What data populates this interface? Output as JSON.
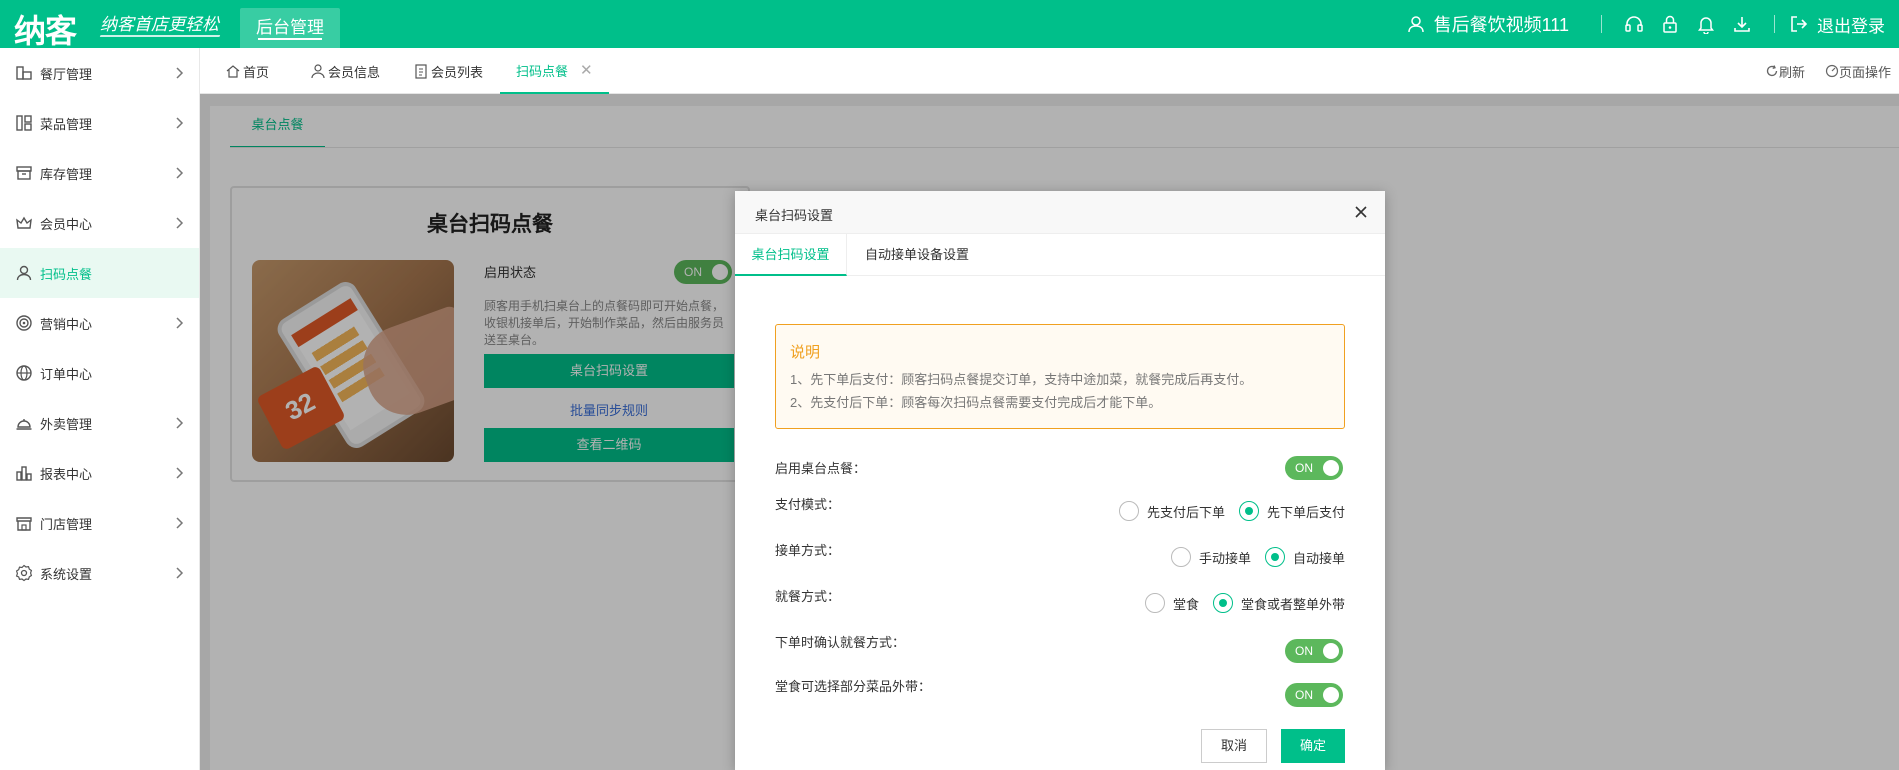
{
  "header": {
    "logo_text": "纳客",
    "slogan": "纳客首店更轻松",
    "backend_tab": "后台管理",
    "user_name": "售后餐饮视频111",
    "logout": "退出登录"
  },
  "sidebar": {
    "items": [
      {
        "label": "餐厅管理",
        "icon": "restaurant-icon",
        "has_chevron": true
      },
      {
        "label": "菜品管理",
        "icon": "dishes-icon",
        "has_chevron": true
      },
      {
        "label": "库存管理",
        "icon": "inventory-icon",
        "has_chevron": true
      },
      {
        "label": "会员中心",
        "icon": "crown-icon",
        "has_chevron": true
      },
      {
        "label": "扫码点餐",
        "icon": "user-icon",
        "has_chevron": false,
        "active": true
      },
      {
        "label": "营销中心",
        "icon": "target-icon",
        "has_chevron": true
      },
      {
        "label": "订单中心",
        "icon": "globe-icon",
        "has_chevron": false
      },
      {
        "label": "外卖管理",
        "icon": "cloche-icon",
        "has_chevron": true
      },
      {
        "label": "报表中心",
        "icon": "bar-chart-icon",
        "has_chevron": true
      },
      {
        "label": "门店管理",
        "icon": "store-icon",
        "has_chevron": true
      },
      {
        "label": "系统设置",
        "icon": "gear-icon",
        "has_chevron": true
      }
    ]
  },
  "tabs": {
    "items": [
      {
        "label": "首页",
        "icon": "home-icon"
      },
      {
        "label": "会员信息",
        "icon": "member-icon"
      },
      {
        "label": "会员列表",
        "icon": "clipboard-icon"
      },
      {
        "label": "扫码点餐",
        "active": true,
        "closable": true
      }
    ],
    "refresh": "刷新",
    "page_ops": "页面操作"
  },
  "content": {
    "sub_tab": "桌台点餐",
    "card": {
      "title": "桌台扫码点餐",
      "status_label": "启用状态",
      "status_toggle": "ON",
      "description": "顾客用手机扫桌台上的点餐码即可开始点餐，收银机接单后，开始制作菜品，然后由服务员送至桌台。",
      "settings_button": "桌台扫码设置",
      "sync_link": "批量同步规则",
      "qrcode_button": "查看二维码",
      "image_tag": "32"
    }
  },
  "modal": {
    "title": "桌台扫码设置",
    "tabs": [
      "桌台扫码设置",
      "自动接单设备设置"
    ],
    "notice": {
      "title": "说明",
      "lines": [
        "1、先下单后支付：顾客扫码点餐提交订单，支持中途加菜，就餐完成后再支付。",
        "2、先支付后下单：顾客每次扫码点餐需要支付完成后才能下单。"
      ]
    },
    "settings": {
      "enable": {
        "label": "启用桌台点餐：",
        "value": "ON"
      },
      "payment": {
        "label": "支付模式：",
        "options": [
          "先支付后下单",
          "先下单后支付"
        ],
        "selected": "先下单后支付"
      },
      "accept": {
        "label": "接单方式：",
        "options": [
          "手动接单",
          "自动接单"
        ],
        "selected": "自动接单"
      },
      "dining": {
        "label": "就餐方式：",
        "options": [
          "堂食",
          "堂食或者整单外带"
        ],
        "selected": "堂食或者整单外带"
      },
      "confirm_dining": {
        "label": "下单时确认就餐方式：",
        "value": "ON"
      },
      "partial_takeout": {
        "label": "堂食可选择部分菜品外带：",
        "value": "ON"
      }
    },
    "cancel": "取消",
    "confirm": "确定"
  },
  "colors": {
    "brand": "#00bf8a",
    "toggle_on": "#5cb85c",
    "notice_border": "#f0a020",
    "link": "#3a6fd8"
  }
}
